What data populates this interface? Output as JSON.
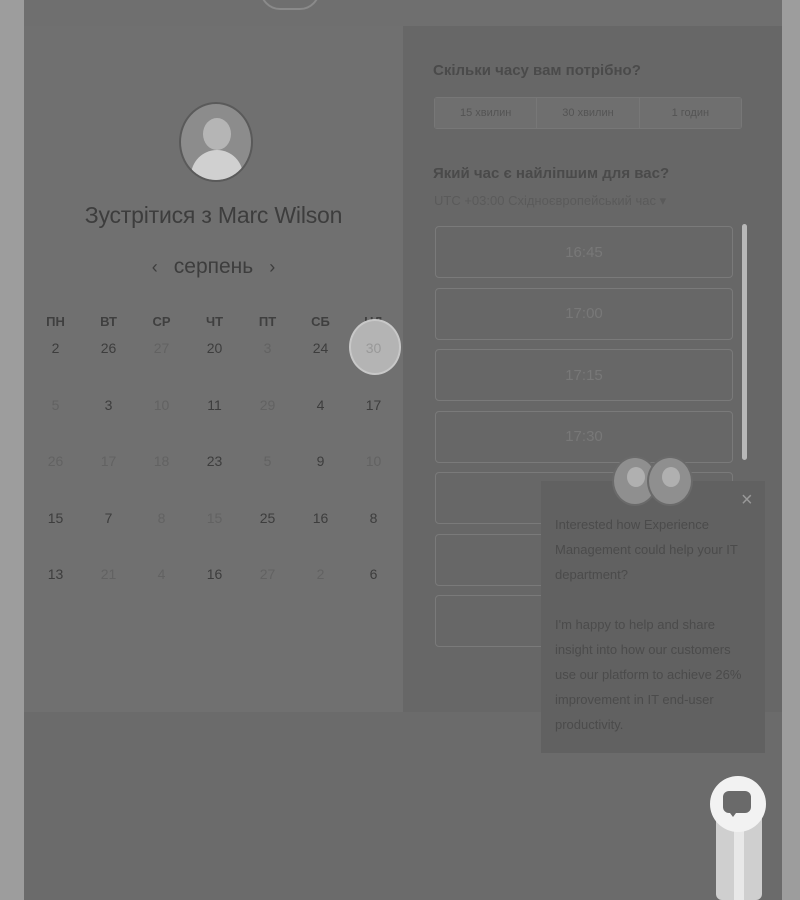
{
  "scheduler": {
    "title": "Зустрітися з Marc Wilson",
    "month": "серпень",
    "weekdays": [
      "ПН",
      "ВТ",
      "СР",
      "ЧТ",
      "ПТ",
      "СБ",
      "НД"
    ],
    "days": [
      [
        "2",
        "26",
        "27",
        "20",
        "3",
        "24",
        "30"
      ],
      [
        "5",
        "3",
        "10",
        "11",
        "29",
        "4",
        "17"
      ],
      [
        "26",
        "17",
        "18",
        "23",
        "5",
        "9",
        "10"
      ],
      [
        "15",
        "7",
        "8",
        "15",
        "25",
        "16",
        "8"
      ],
      [
        "13",
        "21",
        "4",
        "16",
        "27",
        "2",
        "6"
      ]
    ],
    "today": "30"
  },
  "booking": {
    "duration_question": "Скільки часу вам потрібно?",
    "durations": [
      "15 хвилин",
      "30 хвилин",
      "1 годин"
    ],
    "time_question": "Який час є найліпшим для вас?",
    "timezone": "UTC +03:00 Східноєвропейський час ▾",
    "slots": [
      "16:45",
      "17:00",
      "17:15",
      "17:30",
      "",
      "",
      ""
    ]
  },
  "chat": {
    "message_1": "Interested how Experience Management could help your IT department?",
    "message_2": "I'm happy to help and share insight into how our customers use our platform to achieve 26% improvement in IT end-user productivity.",
    "close": "×"
  }
}
